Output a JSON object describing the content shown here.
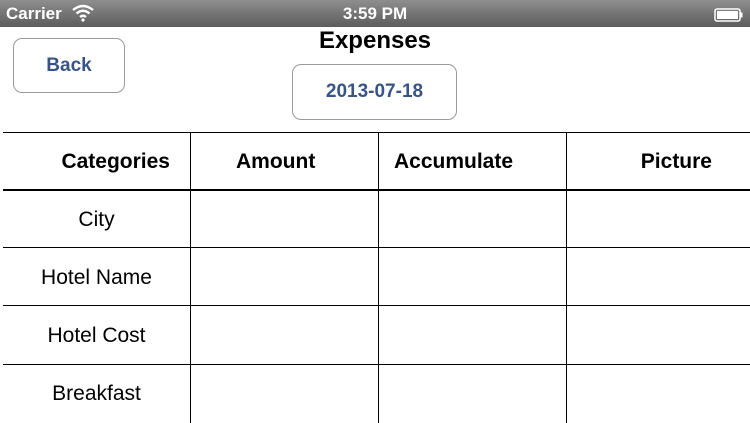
{
  "status_bar": {
    "carrier": "Carrier",
    "time": "3:59 PM",
    "wifi_icon": "wifi-icon",
    "battery_icon": "battery-icon"
  },
  "header": {
    "title": "Expenses",
    "back_label": "Back",
    "date_label": "2013-07-18"
  },
  "table": {
    "columns": [
      "Categories",
      "Amount",
      "Accumulate",
      "Picture"
    ],
    "rows": [
      "City",
      "Hotel Name",
      "Hotel Cost",
      "Breakfast"
    ]
  },
  "colors": {
    "button_text": "#385487",
    "status_bar": "#6e6e6e"
  }
}
